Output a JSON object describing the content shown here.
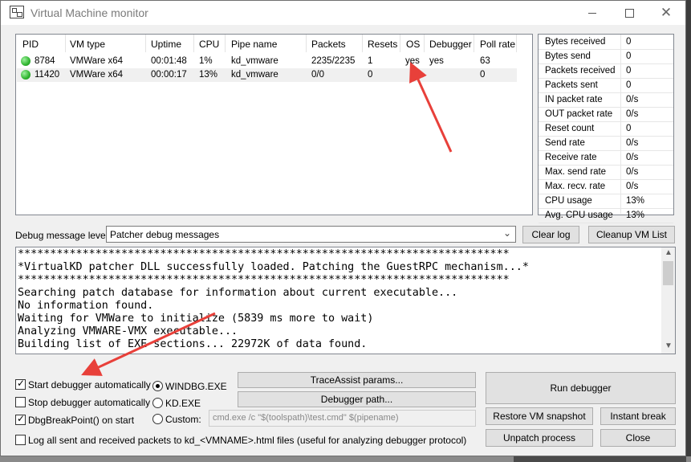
{
  "window": {
    "title": "Virtual Machine monitor"
  },
  "vm_table": {
    "columns": [
      "PID",
      "VM type",
      "Uptime",
      "CPU",
      "Pipe name",
      "Packets",
      "Resets",
      "OS",
      "Debugger",
      "Poll rate"
    ],
    "rows": [
      {
        "pid": "8784",
        "vm_type": "VMWare x64",
        "uptime": "00:01:48",
        "cpu": "1%",
        "pipe": "kd_vmware",
        "packets": "2235/2235",
        "resets": "1",
        "os": "yes",
        "debugger": "yes",
        "poll_rate": "63"
      },
      {
        "pid": "11420",
        "vm_type": "VMWare x64",
        "uptime": "00:00:17",
        "cpu": "13%",
        "pipe": "kd_vmware",
        "packets": "0/0",
        "resets": "0",
        "os": "",
        "debugger": "",
        "poll_rate": "0"
      }
    ]
  },
  "stats": [
    {
      "label": "Bytes received",
      "value": "0"
    },
    {
      "label": "Bytes send",
      "value": "0"
    },
    {
      "label": "Packets received",
      "value": "0"
    },
    {
      "label": "Packets sent",
      "value": "0"
    },
    {
      "label": "IN packet rate",
      "value": "0/s"
    },
    {
      "label": "OUT packet rate",
      "value": "0/s"
    },
    {
      "label": "Reset count",
      "value": "0"
    },
    {
      "label": "Send rate",
      "value": "0/s"
    },
    {
      "label": "Receive rate",
      "value": "0/s"
    },
    {
      "label": "Max. send rate",
      "value": "0/s"
    },
    {
      "label": "Max. recv. rate",
      "value": "0/s"
    },
    {
      "label": "CPU usage",
      "value": "13%"
    },
    {
      "label": "Avg. CPU usage",
      "value": "13%"
    }
  ],
  "debug": {
    "level_label": "Debug message level:",
    "level_value": "Patcher debug messages",
    "clear_log": "Clear log",
    "cleanup_vm_list": "Cleanup VM List"
  },
  "log_lines": [
    "****************************************************************************",
    "*VirtualKD patcher DLL successfully loaded. Patching the GuestRPC mechanism...*",
    "****************************************************************************",
    "Searching patch database for information about current executable...",
    "No information found.",
    "Waiting for VMWare to initialize (5839 ms more to wait)",
    "Analyzing VMWARE-VMX executable...",
    "Building list of EXE sections... 22972K of data found."
  ],
  "options": {
    "start_debugger_auto": "Start debugger automatically",
    "stop_debugger_auto": "Stop debugger automatically",
    "dbgbreakpoint": "DbgBreakPoint() on start",
    "windbg": "WINDBG.EXE",
    "kd": "KD.EXE",
    "custom": "Custom:",
    "custom_cmd": "cmd.exe /c \"$(toolspath)\\test.cmd\" $(pipename)",
    "log_packets": "Log all sent and received packets to kd_<VMNAME>.html files (useful for analyzing debugger protocol)"
  },
  "buttons": {
    "traceassist": "TraceAssist params...",
    "debugger_path": "Debugger path...",
    "run_debugger": "Run debugger",
    "restore_snapshot": "Restore VM snapshot",
    "instant_break": "Instant break",
    "unpatch": "Unpatch process",
    "close": "Close"
  },
  "colors": {
    "status_ok": "#2fb52f",
    "annotation_arrow": "#e8403a"
  }
}
